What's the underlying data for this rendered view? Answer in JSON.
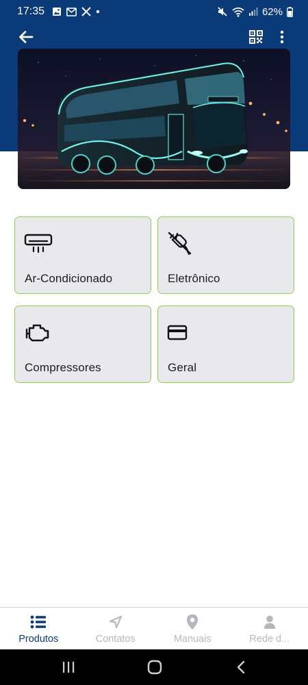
{
  "status_bar": {
    "time": "17:35",
    "battery": "62%",
    "left_icons": [
      "gallery-icon",
      "gmail-icon",
      "x-icon",
      "dot-icon"
    ],
    "right_icons": [
      "mute-icon",
      "wifi-icon",
      "signal-icon",
      "battery-icon"
    ]
  },
  "app_bar": {
    "back_icon": "arrow-left-icon",
    "qr_icon": "qr-code-icon",
    "menu_icon": "more-vertical-icon"
  },
  "colors": {
    "header": "#0b3a78",
    "card_bg": "#e9e8ec",
    "card_border": "#8fd146",
    "nav_active": "#0b3a78",
    "nav_inactive": "#b8b8bc"
  },
  "categories": [
    {
      "label": "Ar-Condicionado",
      "icon": "air-conditioner-icon"
    },
    {
      "label": "Eletrônico",
      "icon": "unplugged-plug-icon"
    },
    {
      "label": "Compressores",
      "icon": "engine-icon"
    },
    {
      "label": "Geral",
      "icon": "credit-card-icon"
    }
  ],
  "bottom_nav": [
    {
      "label": "Produtos",
      "icon": "list-icon",
      "active": true
    },
    {
      "label": "Contatos",
      "icon": "navigation-arrow-icon",
      "active": false
    },
    {
      "label": "Manuais",
      "icon": "map-pin-icon",
      "active": false
    },
    {
      "label": "Rede d...",
      "icon": "person-icon",
      "active": false
    }
  ],
  "system_nav": {
    "recents_icon": "recents-icon",
    "home_icon": "home-icon",
    "back_icon": "back-chevron-icon"
  }
}
